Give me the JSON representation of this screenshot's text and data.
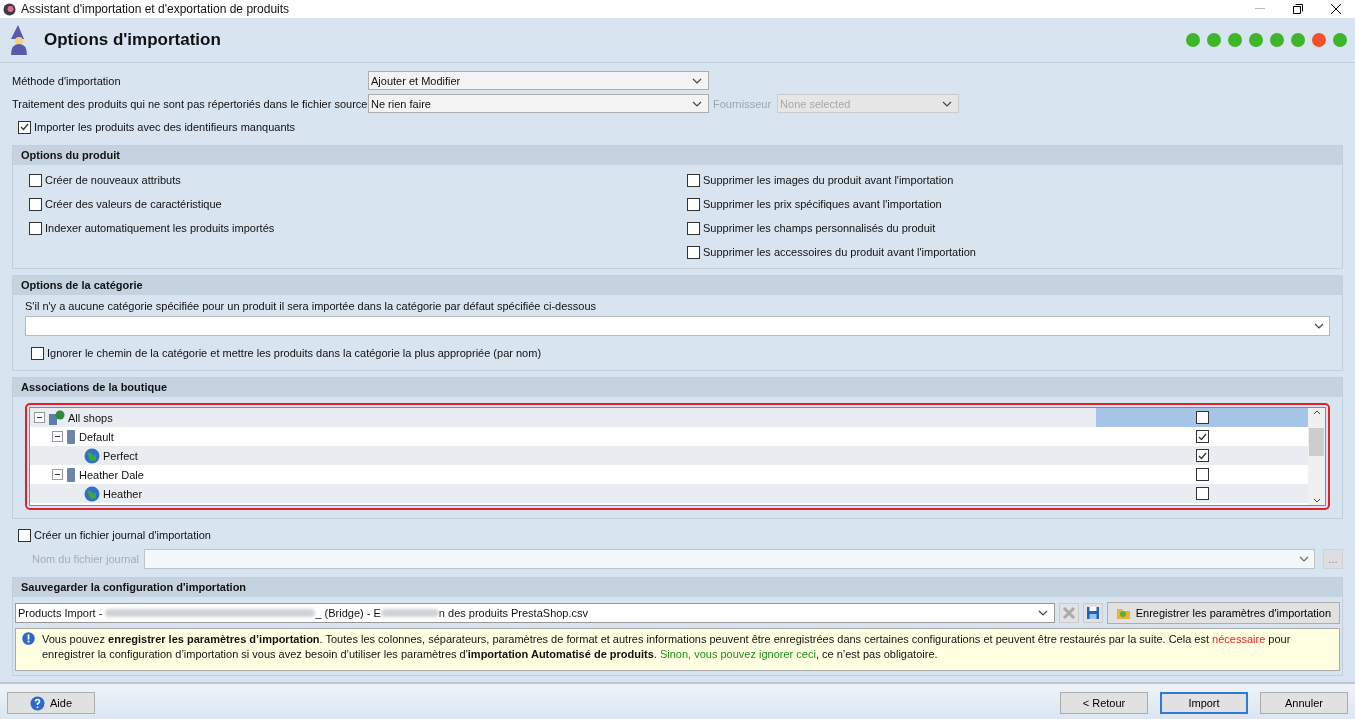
{
  "window": {
    "title": "Assistant d'importation et d'exportation de produits"
  },
  "header": {
    "title": "Options d'importation",
    "steps": [
      {
        "color": "#3fb52a"
      },
      {
        "color": "#3fb52a"
      },
      {
        "color": "#3fb52a"
      },
      {
        "color": "#3fb52a"
      },
      {
        "color": "#3fb52a"
      },
      {
        "color": "#3fb52a"
      },
      {
        "color": "#f0502c"
      },
      {
        "color": "#3fb52a"
      }
    ]
  },
  "import_method": {
    "label": "Méthode d'importation",
    "value": "Ajouter et Modifier"
  },
  "unlisted_products": {
    "label": "Traitement des produits qui ne sont pas répertoriés dans le fichier source",
    "value": "Ne rien faire",
    "supplier_label": "Fournisseur",
    "supplier_value": "None selected",
    "supplier_disabled": true
  },
  "missing_ids": {
    "label": "Importer les produits avec des identifieurs manquants",
    "checked": true
  },
  "product_options": {
    "title": "Options du produit",
    "left": [
      {
        "label": "Créer de nouveaux attributs",
        "checked": false
      },
      {
        "label": "Créer des valeurs de caractéristique",
        "checked": false
      },
      {
        "label": "Indexer automatiquement les produits importés",
        "checked": false
      }
    ],
    "right": [
      {
        "label": "Supprimer les images du produit avant l'importation",
        "checked": false
      },
      {
        "label": "Supprimer les prix spécifiques avant l'importation",
        "checked": false
      },
      {
        "label": "Supprimer les champs personnalisés du produit",
        "checked": false
      },
      {
        "label": "Supprimer les accessoires du produit avant l'importation",
        "checked": false
      }
    ]
  },
  "category_options": {
    "title": "Options de la catégorie",
    "hint": "S'il n'y a aucune catégorie spécifiée pour un produit il sera importée dans la catégorie par défaut spécifiée ci-dessous",
    "ignore_path": {
      "label": "Ignorer le chemin de la catégorie et mettre les produits dans la catégorie la plus appropriée (par nom)",
      "checked": false
    }
  },
  "shop_associations": {
    "title": "Associations de la boutique",
    "tree": [
      {
        "label": "All shops",
        "kind": "root",
        "expanded": true,
        "checked": false,
        "selected": true,
        "children": [
          {
            "label": "Default",
            "kind": "group",
            "expanded": true,
            "checked": true,
            "selected": false,
            "children": [
              {
                "label": "Perfect",
                "kind": "shop",
                "checked": true,
                "selected": false
              }
            ]
          },
          {
            "label": "Heather Dale",
            "kind": "group",
            "expanded": true,
            "checked": false,
            "selected": false,
            "children": [
              {
                "label": "Heather",
                "kind": "shop",
                "checked": false,
                "selected": false
              }
            ]
          }
        ]
      }
    ]
  },
  "log": {
    "label": "Créer un fichier journal d'importation",
    "checked": false,
    "file_label": "Nom du fichier journal",
    "browse": "...",
    "disabled": true
  },
  "save_config": {
    "title": "Sauvegarder la configuration d'importation",
    "config_parts": [
      {
        "kind": "text",
        "text": "Products Import - "
      },
      {
        "kind": "blurred"
      },
      {
        "kind": "text",
        "text": "_ (Bridge) - E"
      },
      {
        "kind": "blurred"
      },
      {
        "kind": "text",
        "text": "n des produits PrestaShop.csv"
      }
    ],
    "save_button": "Enregistrer les paramètres d'importation",
    "info": [
      {
        "kind": "plain",
        "text": "Vous pouvez "
      },
      {
        "kind": "bold",
        "text": "enregistrer les paramètres d’importation"
      },
      {
        "kind": "plain",
        "text": ". Toutes les colonnes, séparateurs, paramètres de format et autres informations peuvent être enregistrées dans certaines configurations et peuvent être restaurés par la suite. Cela est "
      },
      {
        "kind": "red",
        "text": "nécessaire"
      },
      {
        "kind": "plain",
        "text": " pour enregistrer la configuration d’importation si vous avez besoin d’utiliser les paramètres d'"
      },
      {
        "kind": "bold",
        "text": "importation Automatisé de produits"
      },
      {
        "kind": "plain",
        "text": ". "
      },
      {
        "kind": "green",
        "text": "Sinon, vous pouvez ignorer ceci"
      },
      {
        "kind": "plain",
        "text": ", ce n’est pas obligatoire."
      }
    ]
  },
  "footer": {
    "help": "Aide",
    "buttons": [
      {
        "label": "< Retour",
        "selected": false
      },
      {
        "label": "Import",
        "selected": true
      },
      {
        "label": "Annuler",
        "selected": false
      }
    ]
  }
}
